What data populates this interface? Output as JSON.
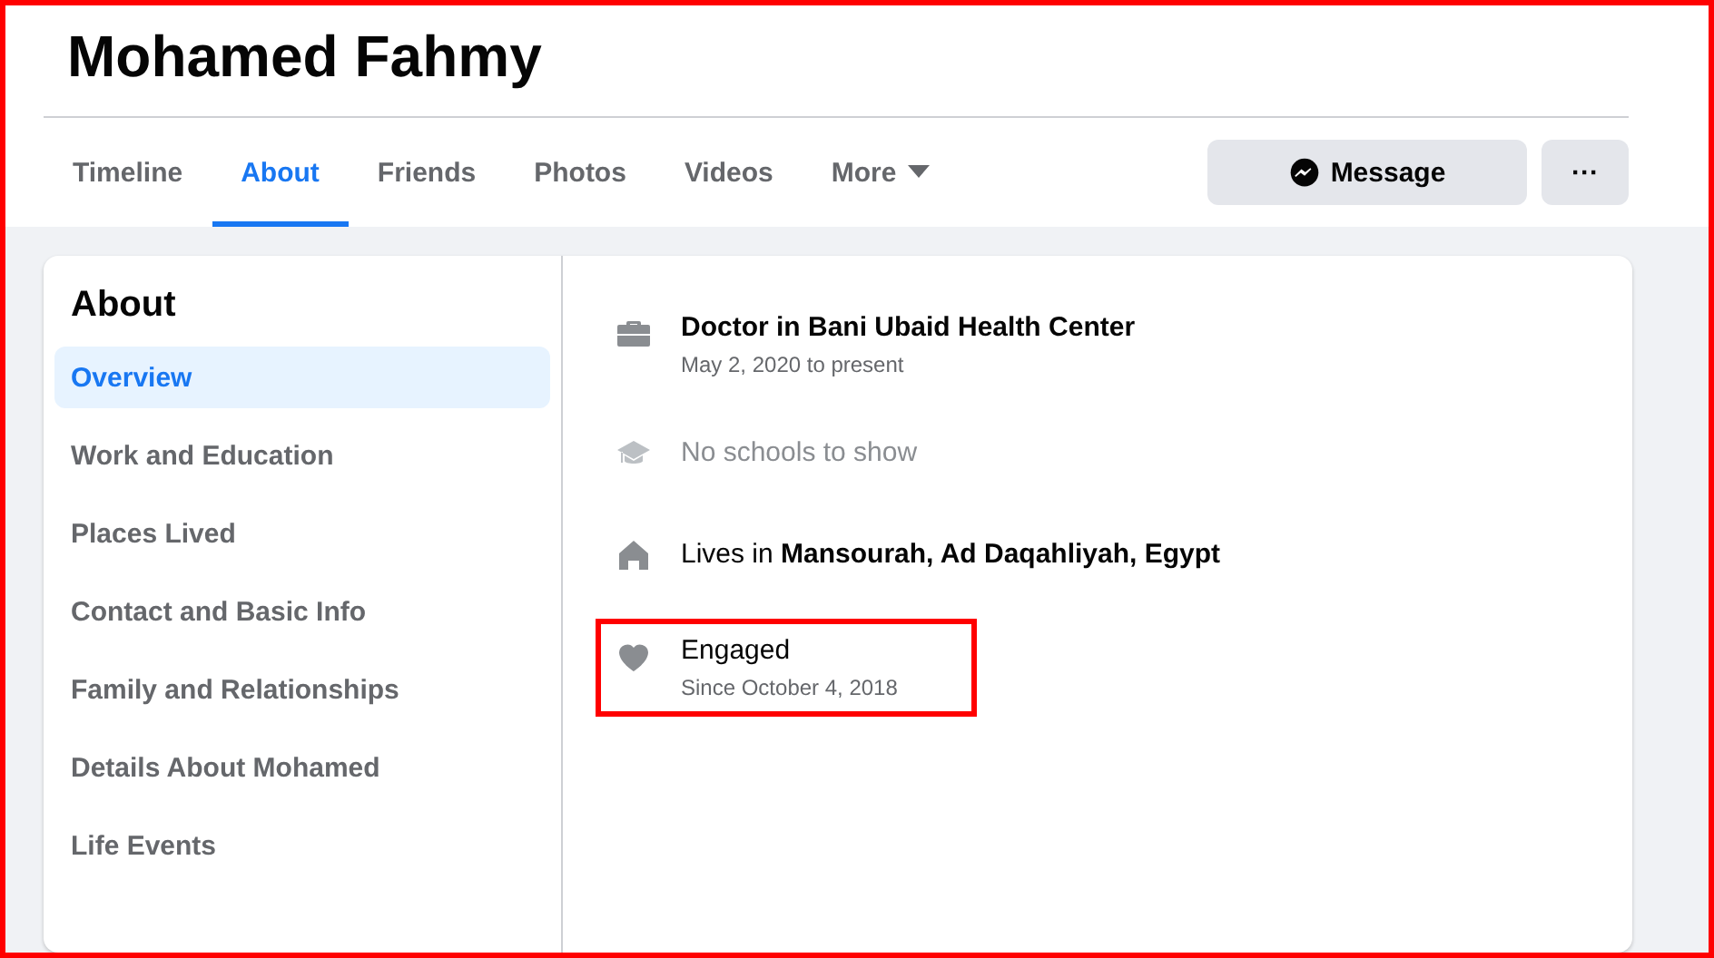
{
  "profile": {
    "name": "Mohamed Fahmy"
  },
  "tabs": [
    {
      "label": "Timeline",
      "selected": false
    },
    {
      "label": "About",
      "selected": true
    },
    {
      "label": "Friends",
      "selected": false
    },
    {
      "label": "Photos",
      "selected": false
    },
    {
      "label": "Videos",
      "selected": false
    },
    {
      "label": "More",
      "selected": false,
      "dropdown": true
    }
  ],
  "actions": {
    "message": "Message",
    "more": "···"
  },
  "sidebar": {
    "title": "About",
    "items": [
      {
        "label": "Overview",
        "selected": true
      },
      {
        "label": "Work and Education",
        "selected": false
      },
      {
        "label": "Places Lived",
        "selected": false
      },
      {
        "label": "Contact and Basic Info",
        "selected": false
      },
      {
        "label": "Family and Relationships",
        "selected": false
      },
      {
        "label": "Details About Mohamed",
        "selected": false
      },
      {
        "label": "Life Events",
        "selected": false
      }
    ]
  },
  "overview": [
    {
      "kind": "work",
      "title": "Doctor in Bani Ubaid Health Center",
      "subtitle": "May 2, 2020 to present",
      "muted": false,
      "highlighted": false
    },
    {
      "kind": "education",
      "title": "No schools to show",
      "muted": true,
      "highlighted": false
    },
    {
      "kind": "home",
      "title": "Lives in **Mansourah, Ad Daqahliyah, Egypt**",
      "muted": false,
      "highlighted": false
    },
    {
      "kind": "relationship",
      "title": "Engaged",
      "subtitle": "Since October 4, 2018",
      "muted": false,
      "highlighted": true
    }
  ]
}
